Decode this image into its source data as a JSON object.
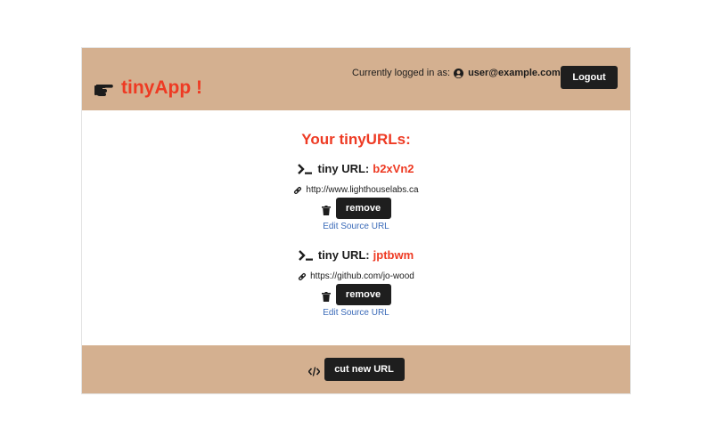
{
  "header": {
    "brand": "tinyApp !",
    "brand_icon": "pointing-hand-icon",
    "login_prefix": "Currently logged in as:",
    "user_icon": "user-circle-icon",
    "user_email": "user@example.com",
    "logout_label": "Logout"
  },
  "main": {
    "title": "Your tinyURLs:",
    "urls": [
      {
        "label": "tiny URL:",
        "short_code": "b2xVn2",
        "long_url": "http://www.lighthouselabs.ca",
        "remove_label": "remove",
        "edit_label": "Edit Source URL"
      },
      {
        "label": "tiny URL:",
        "short_code": "jptbwm",
        "long_url": "https://github.com/jo-wood",
        "remove_label": "remove",
        "edit_label": "Edit Source URL"
      }
    ]
  },
  "footer": {
    "cut_label": "cut new URL",
    "code_icon": "code-icon"
  },
  "colors": {
    "accent": "#ee3a23",
    "band": "#d4b090",
    "button": "#1e1e1e",
    "link": "#3a6ab8"
  }
}
